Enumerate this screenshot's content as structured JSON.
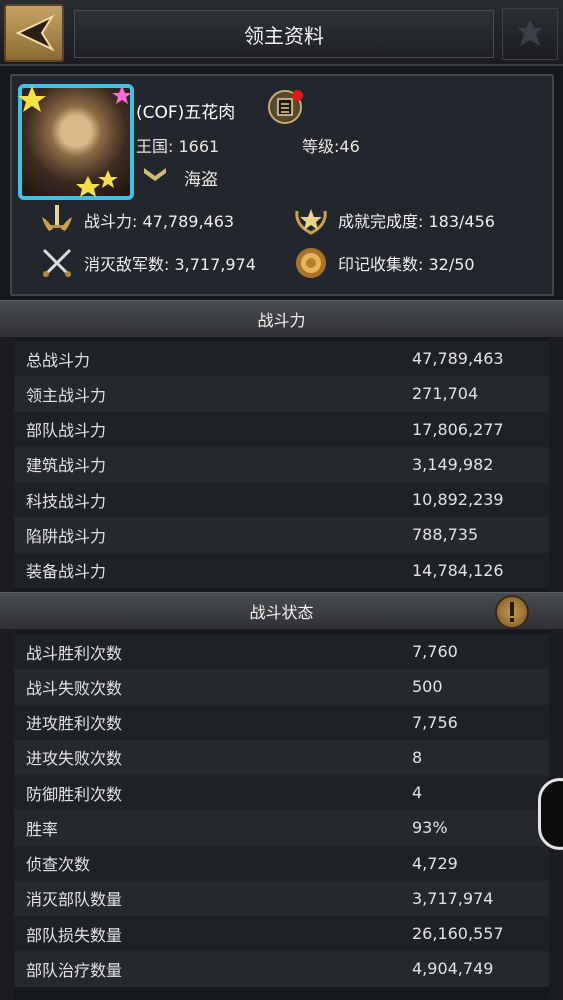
{
  "header": {
    "title": "领主资料"
  },
  "profile": {
    "name": "(COF)五花肉",
    "kingdom": "王国: 1661",
    "level": "等级:46",
    "rank": "海盗",
    "stats": {
      "power": "战斗力: 47,789,463",
      "achievement": "成就完成度: 183/456",
      "kills": "消灭敌军数: 3,717,974",
      "badges": "印记收集数: 32/50"
    }
  },
  "power_section": {
    "title": "战斗力",
    "rows": [
      {
        "label": "总战斗力",
        "value": "47,789,463"
      },
      {
        "label": "领主战斗力",
        "value": "271,704"
      },
      {
        "label": "部队战斗力",
        "value": "17,806,277"
      },
      {
        "label": "建筑战斗力",
        "value": "3,149,982"
      },
      {
        "label": "科技战斗力",
        "value": "10,892,239"
      },
      {
        "label": "陷阱战斗力",
        "value": "788,735"
      },
      {
        "label": "装备战斗力",
        "value": "14,784,126"
      }
    ]
  },
  "battle_section": {
    "title": "战斗状态",
    "rows": [
      {
        "label": "战斗胜利次数",
        "value": "7,760"
      },
      {
        "label": "战斗失败次数",
        "value": "500"
      },
      {
        "label": "进攻胜利次数",
        "value": "7,756"
      },
      {
        "label": "进攻失败次数",
        "value": "8"
      },
      {
        "label": "防御胜利次数",
        "value": "4"
      },
      {
        "label": "胜率",
        "value": "93%"
      },
      {
        "label": "侦查次数",
        "value": "4,729"
      },
      {
        "label": "消灭部队数量",
        "value": "3,717,974"
      },
      {
        "label": "部队损失数量",
        "value": "26,160,557"
      },
      {
        "label": "部队治疗数量",
        "value": "4,904,749"
      }
    ]
  },
  "icons": {
    "back": "back-arrow-icon",
    "mail": "mail-icon",
    "power": "sword-wings-icon",
    "achievement": "laurel-star-icon",
    "kills": "crossed-swords-icon",
    "badges": "seal-medal-icon",
    "info": "exclamation-icon"
  }
}
